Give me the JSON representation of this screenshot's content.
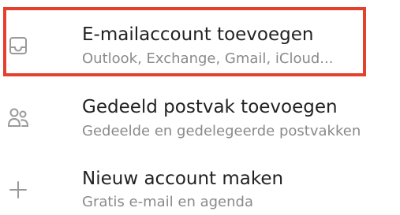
{
  "options": [
    {
      "title": "E-mailaccount toevoegen",
      "subtitle": "Outlook, Exchange, Gmail, iCloud...",
      "icon": "inbox-icon",
      "highlighted": true
    },
    {
      "title": "Gedeeld postvak toevoegen",
      "subtitle": "Gedeelde en gedelegeerde postvakken",
      "icon": "people-icon",
      "highlighted": false
    },
    {
      "title": "Nieuw account maken",
      "subtitle": "Gratis e-mail en agenda",
      "icon": "plus-icon",
      "highlighted": false
    }
  ],
  "colors": {
    "highlight_border": "#e3402e",
    "title_text": "#222222",
    "subtitle_text": "#8a8a8a",
    "icon_stroke": "#9a9a9a"
  }
}
